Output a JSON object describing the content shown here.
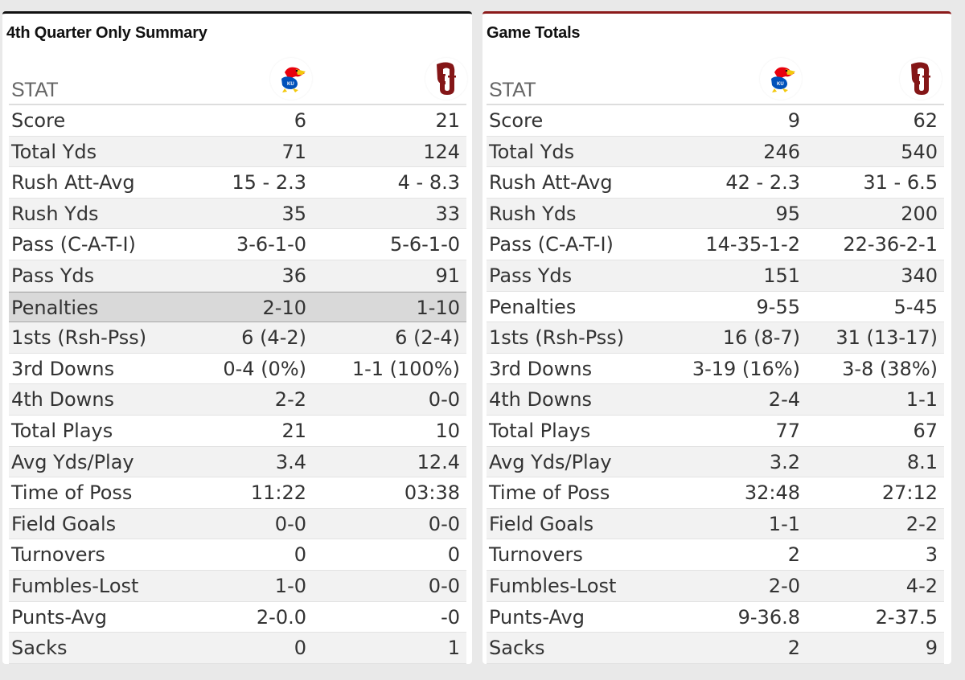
{
  "colors": {
    "background": "#e9e9e9",
    "left_panel_accent": "#111111",
    "right_panel_accent": "#8b1a1a",
    "row_stripe": "#f2f2f2",
    "row_highlight": "#d9d9d9",
    "ku_blue": "#0051ba",
    "ku_red": "#e8000d",
    "ku_yellow": "#f3c80b",
    "ou_crimson": "#841617"
  },
  "panels": [
    {
      "title": "4th Quarter Only Summary",
      "stat_header": "STAT",
      "team1_logo": "kansas-jayhawk-logo",
      "team2_logo": "oklahoma-ou-logo",
      "highlighted_row": "Penalties",
      "rows": [
        {
          "stat": "Score",
          "team1": "6",
          "team2": "21"
        },
        {
          "stat": "Total Yds",
          "team1": "71",
          "team2": "124"
        },
        {
          "stat": "Rush Att-Avg",
          "team1": "15 - 2.3",
          "team2": "4 - 8.3"
        },
        {
          "stat": "Rush Yds",
          "team1": "35",
          "team2": "33"
        },
        {
          "stat": "Pass (C-A-T-I)",
          "team1": "3-6-1-0",
          "team2": "5-6-1-0"
        },
        {
          "stat": "Pass Yds",
          "team1": "36",
          "team2": "91"
        },
        {
          "stat": "Penalties",
          "team1": "2-10",
          "team2": "1-10"
        },
        {
          "stat": "1sts (Rsh-Pss)",
          "team1": "6 (4-2)",
          "team2": "6 (2-4)"
        },
        {
          "stat": "3rd Downs",
          "team1": "0-4 (0%)",
          "team2": "1-1 (100%)"
        },
        {
          "stat": "4th Downs",
          "team1": "2-2",
          "team2": "0-0"
        },
        {
          "stat": "Total Plays",
          "team1": "21",
          "team2": "10"
        },
        {
          "stat": "Avg Yds/Play",
          "team1": "3.4",
          "team2": "12.4"
        },
        {
          "stat": "Time of Poss",
          "team1": "11:22",
          "team2": "03:38"
        },
        {
          "stat": "Field Goals",
          "team1": "0-0",
          "team2": "0-0"
        },
        {
          "stat": "Turnovers",
          "team1": "0",
          "team2": "0"
        },
        {
          "stat": "Fumbles-Lost",
          "team1": "1-0",
          "team2": "0-0"
        },
        {
          "stat": "Punts-Avg",
          "team1": "2-0.0",
          "team2": "-0"
        },
        {
          "stat": "Sacks",
          "team1": "0",
          "team2": "1"
        }
      ]
    },
    {
      "title": "Game Totals",
      "stat_header": "STAT",
      "team1_logo": "kansas-jayhawk-logo",
      "team2_logo": "oklahoma-ou-logo",
      "highlighted_row": null,
      "rows": [
        {
          "stat": "Score",
          "team1": "9",
          "team2": "62"
        },
        {
          "stat": "Total Yds",
          "team1": "246",
          "team2": "540"
        },
        {
          "stat": "Rush Att-Avg",
          "team1": "42 - 2.3",
          "team2": "31 - 6.5"
        },
        {
          "stat": "Rush Yds",
          "team1": "95",
          "team2": "200"
        },
        {
          "stat": "Pass (C-A-T-I)",
          "team1": "14-35-1-2",
          "team2": "22-36-2-1"
        },
        {
          "stat": "Pass Yds",
          "team1": "151",
          "team2": "340"
        },
        {
          "stat": "Penalties",
          "team1": "9-55",
          "team2": "5-45"
        },
        {
          "stat": "1sts (Rsh-Pss)",
          "team1": "16 (8-7)",
          "team2": "31 (13-17)"
        },
        {
          "stat": "3rd Downs",
          "team1": "3-19 (16%)",
          "team2": "3-8 (38%)"
        },
        {
          "stat": "4th Downs",
          "team1": "2-4",
          "team2": "1-1"
        },
        {
          "stat": "Total Plays",
          "team1": "77",
          "team2": "67"
        },
        {
          "stat": "Avg Yds/Play",
          "team1": "3.2",
          "team2": "8.1"
        },
        {
          "stat": "Time of Poss",
          "team1": "32:48",
          "team2": "27:12"
        },
        {
          "stat": "Field Goals",
          "team1": "1-1",
          "team2": "2-2"
        },
        {
          "stat": "Turnovers",
          "team1": "2",
          "team2": "3"
        },
        {
          "stat": "Fumbles-Lost",
          "team1": "2-0",
          "team2": "4-2"
        },
        {
          "stat": "Punts-Avg",
          "team1": "9-36.8",
          "team2": "2-37.5"
        },
        {
          "stat": "Sacks",
          "team1": "2",
          "team2": "9"
        }
      ]
    }
  ]
}
